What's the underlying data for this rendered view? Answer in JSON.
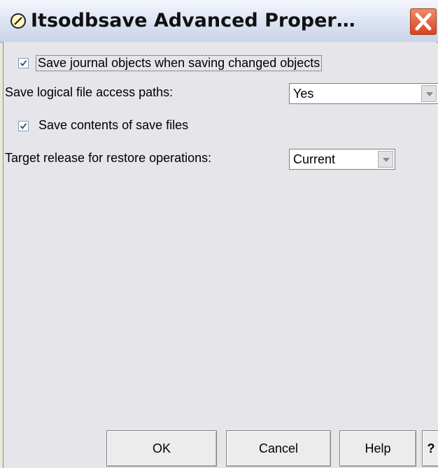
{
  "window": {
    "title": "Itsodbsave  Advanced Proper…",
    "icon": "app-icon",
    "close_icon": "close-icon"
  },
  "options": {
    "save_journal": {
      "label": "Save journal objects when saving changed objects",
      "checked": true
    },
    "access_paths": {
      "label": "Save logical file access paths:",
      "value": "Yes"
    },
    "save_files": {
      "label": "Save contents of save files",
      "checked": true
    },
    "target_release": {
      "label": "Target release for restore operations:",
      "value": "Current"
    }
  },
  "buttons": {
    "ok": "OK",
    "cancel": "Cancel",
    "help": "Help",
    "whats_this": "?"
  },
  "colors": {
    "close_button": "#d8441e",
    "dialog_background": "#e6e6ea"
  }
}
